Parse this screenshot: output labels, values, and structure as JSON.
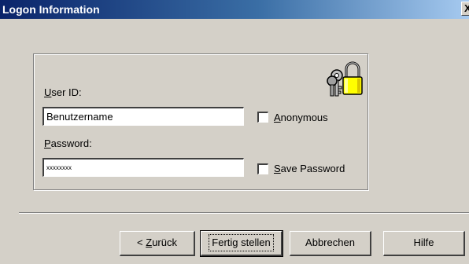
{
  "window": {
    "title": "Logon Information",
    "close_label": "X"
  },
  "form": {
    "user_id_prefix": "U",
    "user_id_rest": "ser ID:",
    "user_id_value": "Benutzername",
    "password_prefix": "P",
    "password_rest": "assword:",
    "password_value": "xxxxxxxx",
    "anonymous_prefix": "A",
    "anonymous_rest": "nonymous",
    "anonymous_checked": false,
    "save_prefix": "S",
    "save_rest": "ave Password",
    "save_checked": false
  },
  "buttons": {
    "back_pre": "< ",
    "back_ul": "Z",
    "back_rest": "urück",
    "finish": "Fertig stellen",
    "cancel": "Abbrechen",
    "help": "Hilfe"
  },
  "icons": {
    "lock": "lock-with-keys-icon"
  }
}
